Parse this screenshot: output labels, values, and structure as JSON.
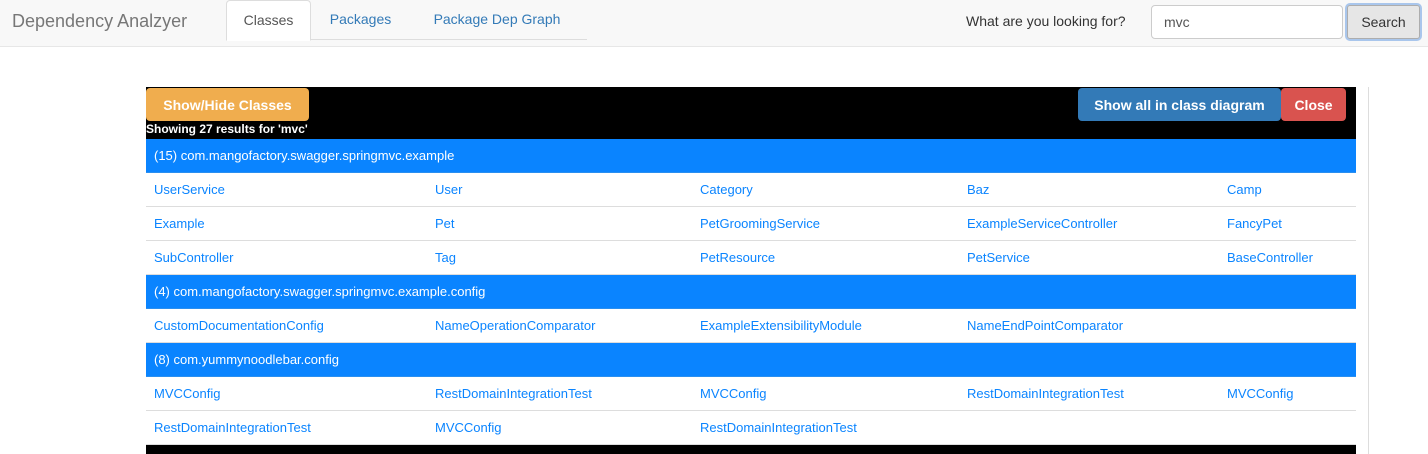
{
  "app": {
    "title": "Dependency Analzyer"
  },
  "tabs": [
    {
      "label": "Classes",
      "active": true
    },
    {
      "label": "Packages",
      "active": false
    },
    {
      "label": "Package Dep Graph",
      "active": false
    }
  ],
  "search": {
    "label": "What are you looking for?",
    "value": "mvc",
    "button_label": "Search"
  },
  "panel": {
    "toggle_label": "Show/Hide Classes",
    "diagram_label": "Show all in class diagram",
    "close_label": "Close",
    "summary": "Showing 27 results for 'mvc'"
  },
  "groups": [
    {
      "header": "(15) com.mangofactory.swagger.springmvc.example",
      "rows": [
        [
          "UserService",
          "User",
          "Category",
          "Baz",
          "Camp"
        ],
        [
          "Example",
          "Pet",
          "PetGroomingService",
          "ExampleServiceController",
          "FancyPet"
        ],
        [
          "SubController",
          "Tag",
          "PetResource",
          "PetService",
          "BaseController"
        ]
      ]
    },
    {
      "header": "(4) com.mangofactory.swagger.springmvc.example.config",
      "rows": [
        [
          "CustomDocumentationConfig",
          "NameOperationComparator",
          "ExampleExtensibilityModule",
          "NameEndPointComparator"
        ]
      ]
    },
    {
      "header": "(8) com.yummynoodlebar.config",
      "rows": [
        [
          "MVCConfig",
          "RestDomainIntegrationTest",
          "MVCConfig",
          "RestDomainIntegrationTest",
          "MVCConfig"
        ],
        [
          "RestDomainIntegrationTest",
          "MVCConfig",
          "RestDomainIntegrationTest"
        ]
      ]
    }
  ],
  "colors": {
    "package_header": "#0a84ff",
    "link": "#0a84ff",
    "toggle_button": "#f0ad4e",
    "diagram_button": "#337ab7",
    "close_button": "#d9534f"
  }
}
